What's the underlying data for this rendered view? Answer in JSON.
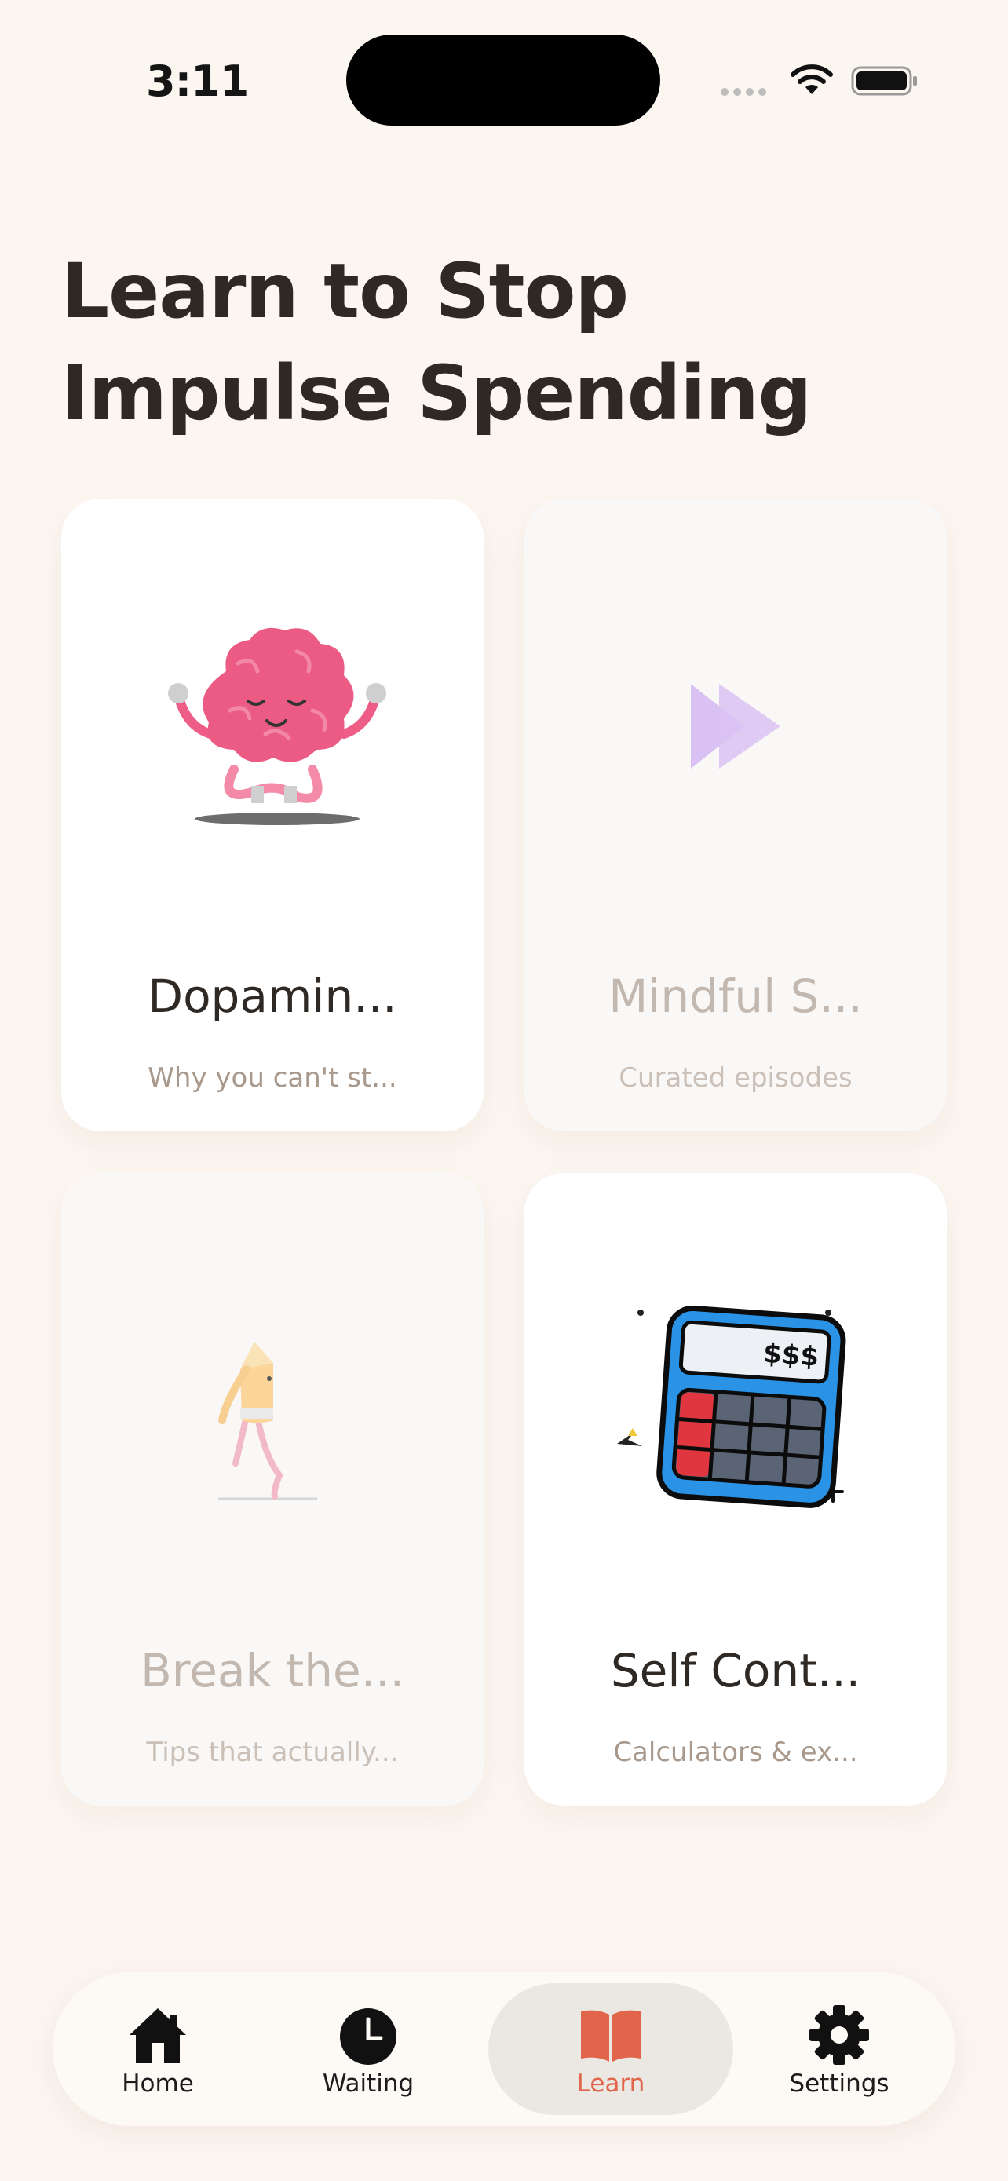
{
  "status_bar": {
    "time": "3:11"
  },
  "page": {
    "title": "Learn to Stop Impulse Spending"
  },
  "cards": [
    {
      "title": "Dopamin...",
      "subtitle": "Why you can't st...",
      "icon": "meditating-brain-icon",
      "state": "enabled"
    },
    {
      "title": "Mindful S...",
      "subtitle": "Curated episodes",
      "icon": "fast-forward-icon",
      "state": "disabled"
    },
    {
      "title": "Break the...",
      "subtitle": "Tips that actually...",
      "icon": "walking-pencil-icon",
      "state": "disabled"
    },
    {
      "title": "Self Cont...",
      "subtitle": "Calculators & ex...",
      "icon": "calculator-icon",
      "state": "enabled"
    }
  ],
  "tab_bar": {
    "tabs": [
      {
        "label": "Home",
        "icon": "house-icon",
        "active": false
      },
      {
        "label": "Waiting",
        "icon": "clock-icon",
        "active": false
      },
      {
        "label": "Learn",
        "icon": "book-icon",
        "active": true
      },
      {
        "label": "Settings",
        "icon": "gear-icon",
        "active": false
      }
    ]
  },
  "colors": {
    "background": "#fcf6f1",
    "accent": "#e0654a",
    "text_primary": "#2e2924",
    "text_secondary": "#a8998c"
  },
  "calculator_display": "$$$"
}
